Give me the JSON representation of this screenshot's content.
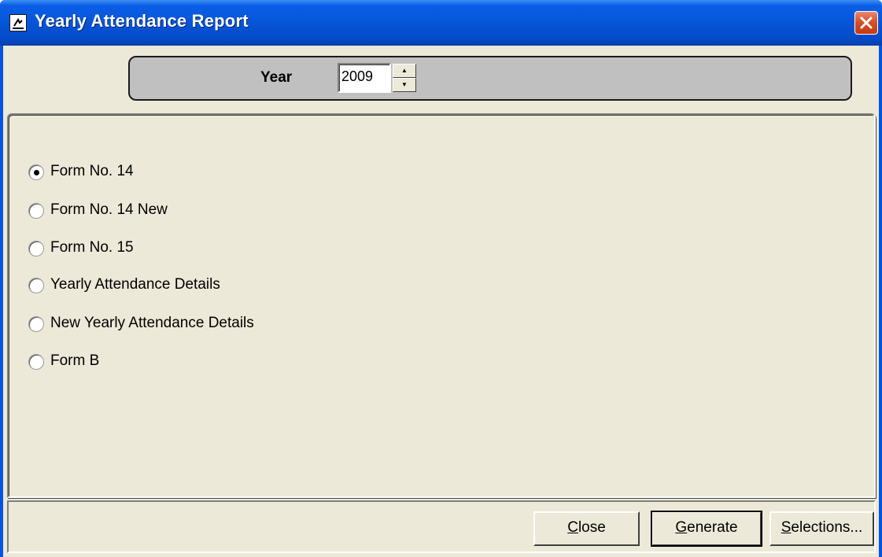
{
  "window": {
    "title": "Yearly Attendance Report"
  },
  "year_selector": {
    "label": "Year",
    "value": "2009"
  },
  "report_options": [
    {
      "label": "Form No. 14",
      "selected": true
    },
    {
      "label": "Form No. 14 New",
      "selected": false
    },
    {
      "label": "Form No. 15",
      "selected": false
    },
    {
      "label": "Yearly Attendance Details",
      "selected": false
    },
    {
      "label": "New Yearly Attendance Details",
      "selected": false
    },
    {
      "label": "Form B",
      "selected": false
    }
  ],
  "buttons": {
    "close": {
      "mnemonic": "C",
      "rest": "lose"
    },
    "generate": {
      "mnemonic": "G",
      "rest": "enerate"
    },
    "selections": {
      "mnemonic": "S",
      "rest": "elections..."
    }
  },
  "colors": {
    "titlebar": "#0655d8",
    "client_bg": "#ece9d8",
    "year_panel_bg": "#c0c0c0",
    "close_button": "#d8512b"
  }
}
